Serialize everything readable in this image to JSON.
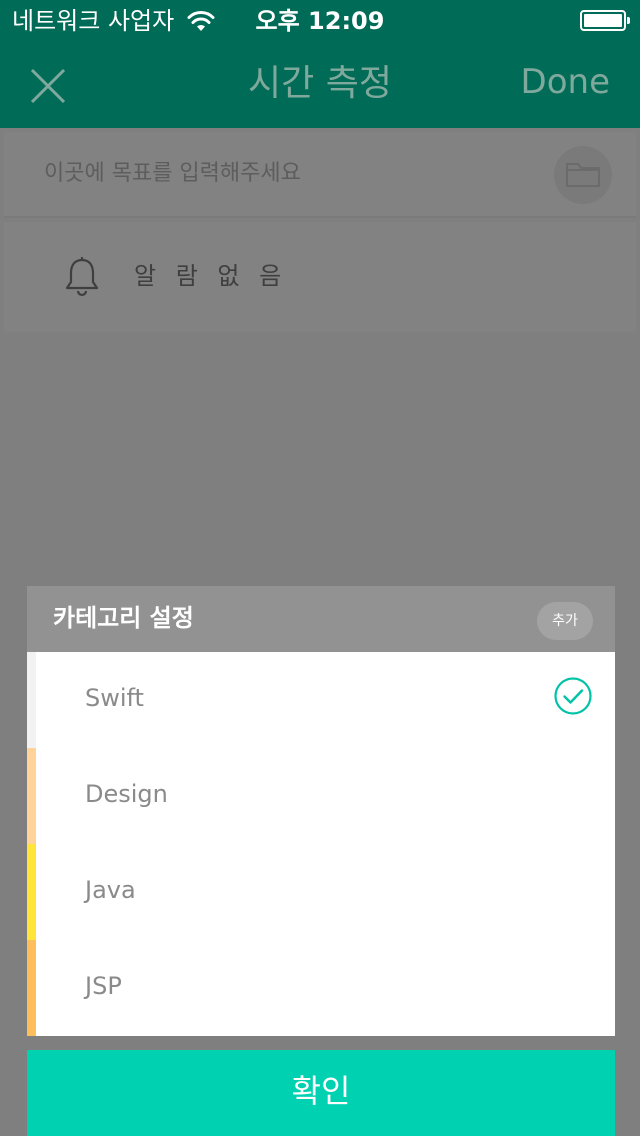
{
  "status_bar": {
    "carrier": "네트워크 사업자",
    "time": "오후 12:09"
  },
  "nav": {
    "title": "시간 측정",
    "done_label": "Done",
    "close_icon": "close-icon"
  },
  "goal": {
    "placeholder": "이곳에 목표를 입력해주세요",
    "folder_icon": "folder-icon"
  },
  "alarm": {
    "label": "알 람 없 음",
    "icon": "bell-icon"
  },
  "modal": {
    "title": "카테고리 설정",
    "add_label": "추가",
    "categories": [
      {
        "name": "Swift",
        "color": "#f2f2f2",
        "selected": true
      },
      {
        "name": "Design",
        "color": "#ffd39a",
        "selected": false
      },
      {
        "name": "Java",
        "color": "#ffe43a",
        "selected": false
      },
      {
        "name": "JSP",
        "color": "#ffbe5c",
        "selected": false
      }
    ],
    "confirm_label": "확인"
  },
  "colors": {
    "header_bg": "#006b56",
    "accent": "#00d2b1",
    "overlay": "#7f7f7f"
  }
}
